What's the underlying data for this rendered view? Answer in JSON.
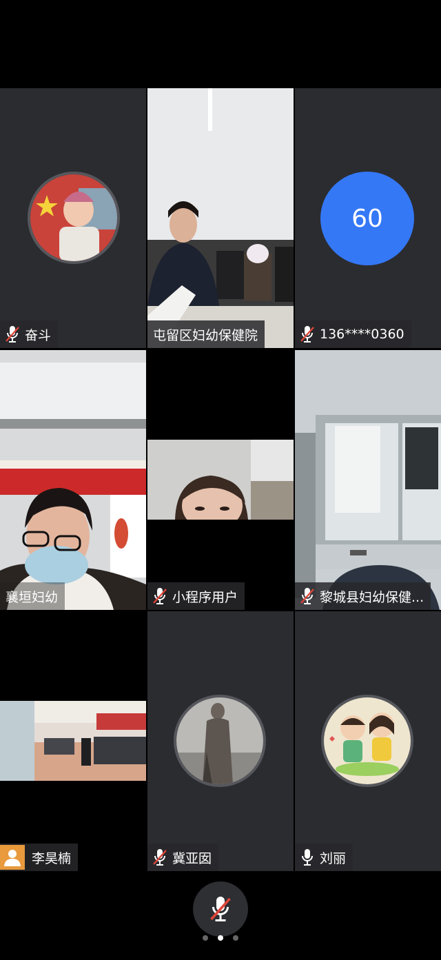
{
  "participants": [
    {
      "name": "奋斗",
      "muted": true,
      "avatar_icon": "child-flag-avatar"
    },
    {
      "name": "屯留区妇幼保健院",
      "muted": false,
      "video": true
    },
    {
      "name": "136****0360",
      "muted": true,
      "avatar_text": "60"
    },
    {
      "name": "襄垣妇幼",
      "muted": false,
      "video": true
    },
    {
      "name": "小程序用户",
      "muted": true,
      "video": true
    },
    {
      "name": "黎城县妇幼保健...",
      "muted": true,
      "video": true
    },
    {
      "name": "李昊楠",
      "muted": false,
      "video": true,
      "avatar_icon": "person-icon"
    },
    {
      "name": "冀亚囡",
      "muted": true,
      "avatar_icon": "vintage-photo-avatar"
    },
    {
      "name": "刘丽",
      "muted": false,
      "avatar_icon": "cartoon-kids-avatar"
    }
  ],
  "controls": {
    "mic_state": "muted"
  },
  "pager": {
    "pages": 3,
    "current": 2
  },
  "colors": {
    "tile_bg": "#2b2c30",
    "accent_blue": "#3478f6",
    "mute_red": "#e0453a"
  }
}
